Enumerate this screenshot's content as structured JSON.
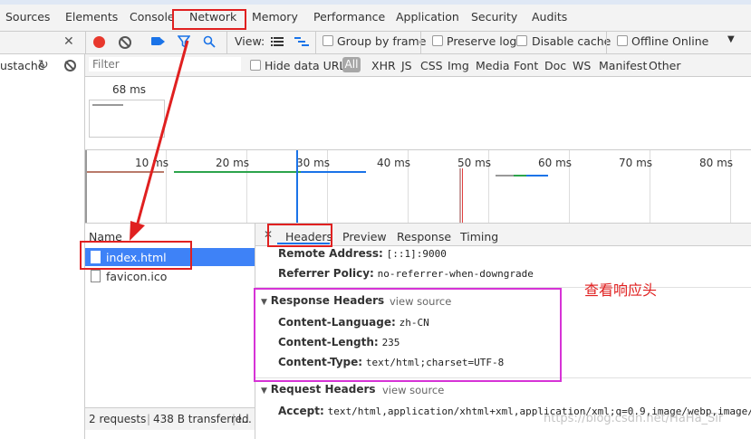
{
  "tabs": [
    "Sources",
    "Elements",
    "Console",
    "Network",
    "Memory",
    "Performance",
    "Application",
    "Security",
    "Audits"
  ],
  "toolbar": {
    "view_label": "View:",
    "group_by_frame": "Group by frame",
    "preserve_log": "Preserve log",
    "disable_cache": "Disable cache",
    "offline": "Offline",
    "online": "Online"
  },
  "left": {
    "snippet": "ustache"
  },
  "filter": {
    "placeholder": "Filter",
    "hide_data_urls": "Hide data URLs",
    "types": [
      "All",
      "XHR",
      "JS",
      "CSS",
      "Img",
      "Media",
      "Font",
      "Doc",
      "WS",
      "Manifest",
      "Other"
    ]
  },
  "overview": {
    "time": "68 ms"
  },
  "timeline": {
    "ticks": [
      "10 ms",
      "20 ms",
      "30 ms",
      "40 ms",
      "50 ms",
      "60 ms",
      "70 ms",
      "80 ms"
    ]
  },
  "name_column": {
    "header": "Name",
    "rows": [
      "index.html",
      "favicon.ico"
    ]
  },
  "details": {
    "tabs": [
      "Headers",
      "Preview",
      "Response",
      "Timing"
    ],
    "general": [
      {
        "k": "Remote Address:",
        "v": "[::1]:9000"
      },
      {
        "k": "Referrer Policy:",
        "v": "no-referrer-when-downgrade"
      }
    ],
    "response_title": "Response Headers",
    "view_source": "view source",
    "response": [
      {
        "k": "Content-Language:",
        "v": "zh-CN"
      },
      {
        "k": "Content-Length:",
        "v": "235"
      },
      {
        "k": "Content-Type:",
        "v": "text/html;charset=UTF-8"
      }
    ],
    "request_title": "Request Headers",
    "request_view_source": "view source",
    "accept": {
      "k": "Accept:",
      "v": "text/html,application/xhtml+xml,application/xml;q=0.9,image/webp,image/a"
    }
  },
  "annotation": "查看响应头",
  "watermark": "https://blog.csdn.net/HaHa_Sir",
  "status": {
    "requests": "2 requests",
    "transferred": "438 B transferred",
    "more": "l..."
  },
  "colors": {
    "record": "#e8382d",
    "accent": "#1a73e8",
    "annotation_red": "#e02020",
    "annotation_magenta": "#d633d6",
    "selected_row": "#3e82f7"
  }
}
